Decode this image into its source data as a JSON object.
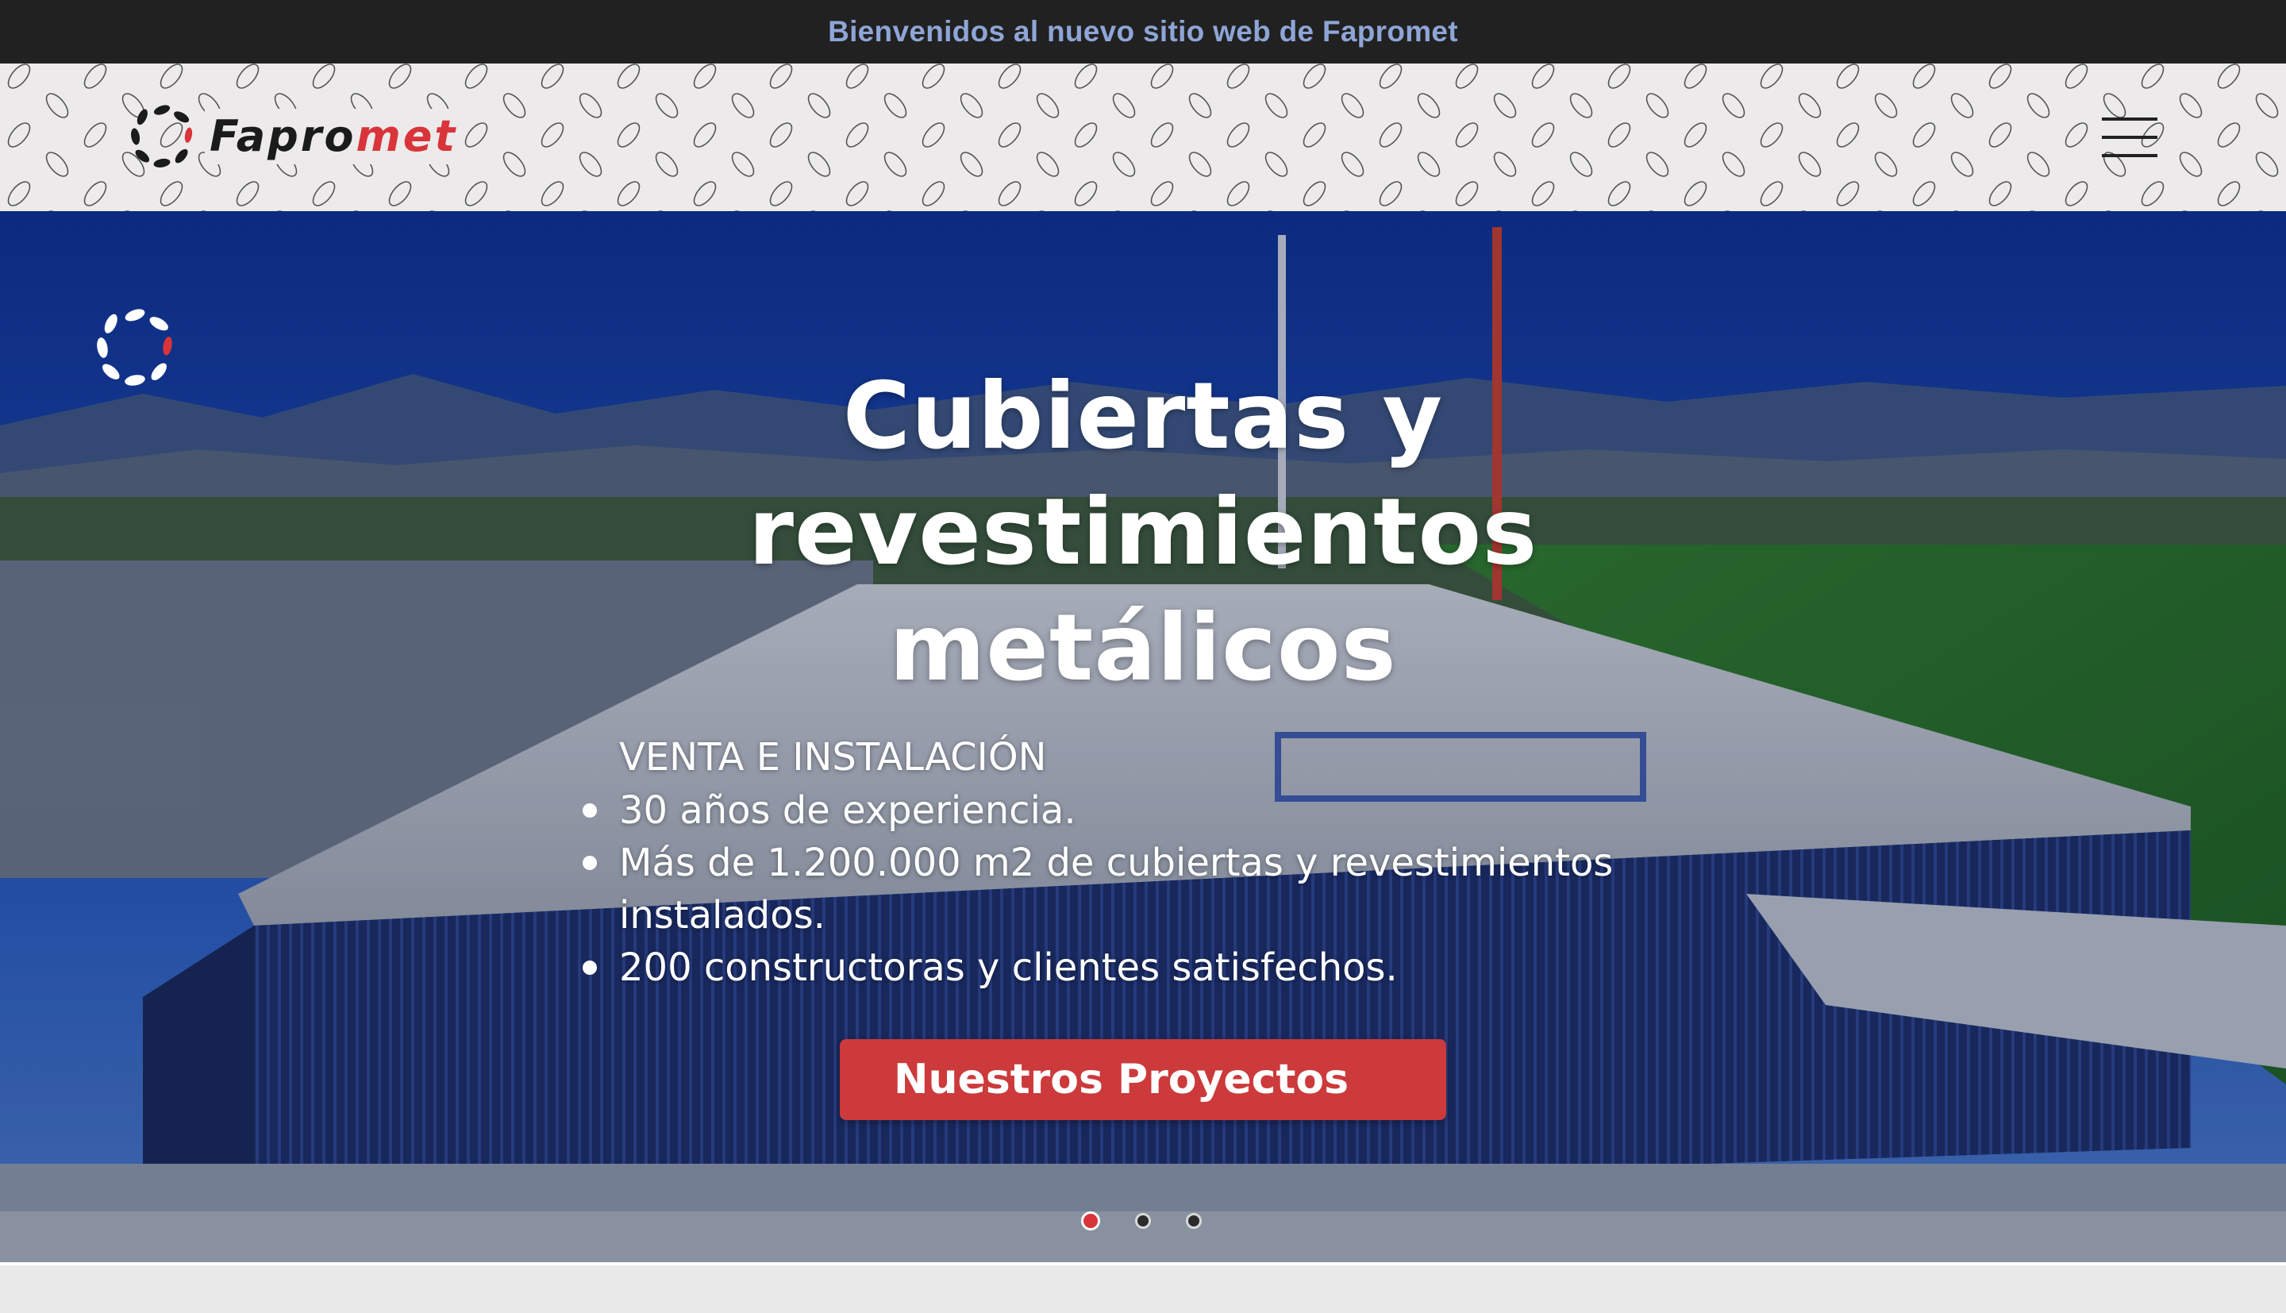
{
  "announcement": {
    "text": "Bienvenidos al nuevo sitio web de Fapromet"
  },
  "header": {
    "logo_text_main": "Fapro",
    "logo_text_accent": "met",
    "menu_icon": "hamburger-menu-icon"
  },
  "hero": {
    "title": "Cubiertas y revestimientos metálicos",
    "subtitle": "VENTA E INSTALACIÓN",
    "bullets": [
      "30 años de experiencia.",
      "Más de 1.200.000 m2 de cubiertas y revestimientos instalados.",
      "200 constructoras y clientes satisfechos."
    ],
    "cta_label": "Nuestros Proyectos",
    "slides_total": 3,
    "active_slide": 1
  },
  "colors": {
    "topbar_bg": "#212121",
    "topbar_text": "#8ea5d6",
    "brand_red": "#cc3a3b",
    "header_bg": "#eceaea"
  }
}
